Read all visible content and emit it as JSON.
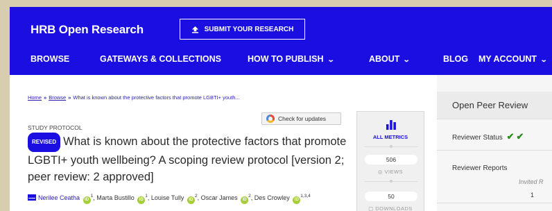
{
  "header": {
    "logo": "HRB Open Research",
    "submit_label": "SUBMIT YOUR RESEARCH",
    "nav": [
      {
        "label": "BROWSE",
        "has_menu": false
      },
      {
        "label": "GATEWAYS & COLLECTIONS",
        "has_menu": false
      },
      {
        "label": "HOW TO PUBLISH",
        "has_menu": true
      },
      {
        "label": "ABOUT",
        "has_menu": true
      },
      {
        "label": "BLOG",
        "has_menu": false
      },
      {
        "label": "MY ACCOUNT",
        "has_menu": true
      }
    ],
    "chevron": "⌄"
  },
  "breadcrumb": {
    "home": "Home",
    "sep": "»",
    "browse": "Browse",
    "current": "What is known about the protective factors that promote LGBTI+ youth..."
  },
  "article": {
    "check_updates": "Check for updates",
    "type": "STUDY PROTOCOL",
    "badge": "REVISED",
    "title": "What is known about the protective factors that promote LGBTI+ youth wellbeing? A scoping review protocol [version 2; peer review: 2 approved]",
    "authors": [
      {
        "name": "Nerilee Ceatha",
        "sup": "1",
        "orcid": true,
        "corresponding": true
      },
      {
        "name": "Marta Bustillo",
        "sup": "1",
        "orcid": true
      },
      {
        "name": "Louise Tully",
        "sup": "2",
        "orcid": true
      },
      {
        "name": "Oscar James",
        "sup": "2",
        "orcid": true
      },
      {
        "name": "Des Crowley",
        "sup": "1,3,4",
        "orcid": true
      }
    ],
    "orcid_text": "iD"
  },
  "metrics": {
    "label": "ALL METRICS",
    "views_value": "506",
    "views_label": "VIEWS",
    "downloads_value": "50",
    "downloads_label": "DOWNLOADS",
    "bar_color": "#1a0fe0"
  },
  "peer_review": {
    "title": "Open Peer Review",
    "status_label": "Reviewer Status",
    "status_checks": [
      "✔",
      "✔"
    ],
    "reports_label": "Reviewer Reports",
    "invited_label": "Invited R",
    "report_number": "1"
  },
  "colors": {
    "brand_blue": "#1a0fe0",
    "approved_green": "#2e8b22",
    "orcid_green": "#a6ce39"
  }
}
